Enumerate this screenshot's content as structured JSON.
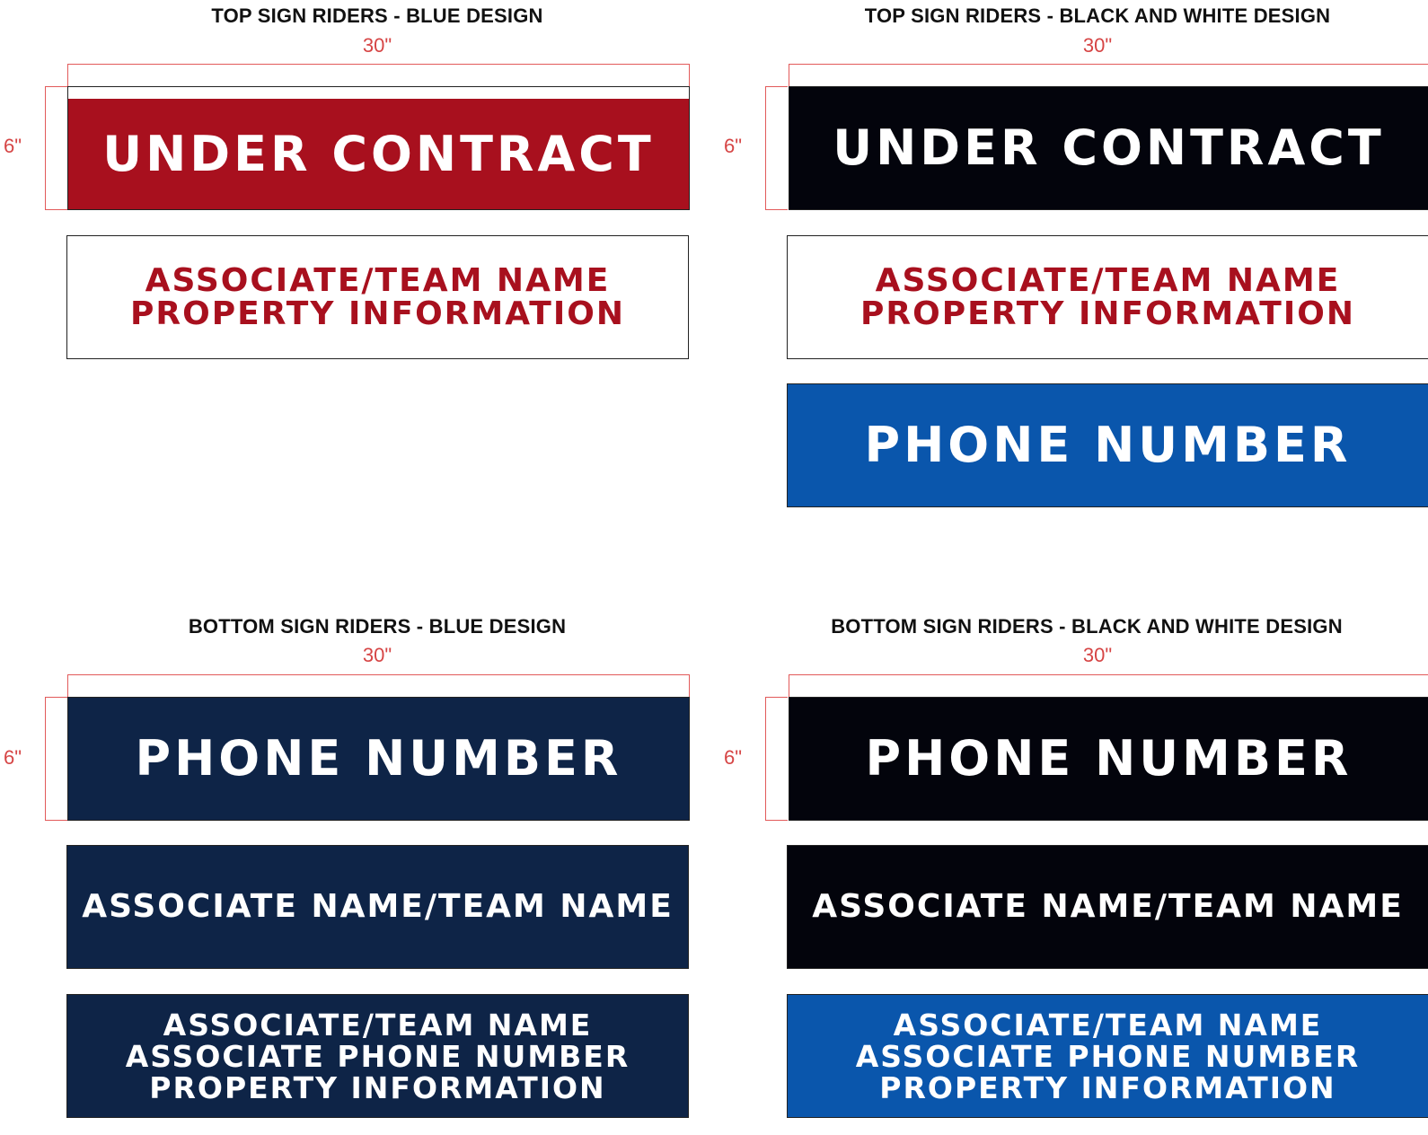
{
  "colors": {
    "red": "#a8101e",
    "black": "#03040c",
    "white": "#ffffff",
    "blue": "#0a56ac",
    "navy": "#0e2447",
    "guide": "#d64545"
  },
  "sections": {
    "top_blue": {
      "title": "TOP SIGN RIDERS - BLUE DESIGN",
      "width_label": "30\"",
      "height_label": "6\"",
      "riders": [
        {
          "lines": [
            "UNDER CONTRACT"
          ]
        },
        {
          "lines": [
            "ASSOCIATE/TEAM NAME",
            "PROPERTY INFORMATION"
          ]
        }
      ]
    },
    "top_bw": {
      "title": "TOP SIGN RIDERS - BLACK AND WHITE DESIGN",
      "width_label": "30\"",
      "height_label": "6\"",
      "riders": [
        {
          "lines": [
            "UNDER CONTRACT"
          ]
        },
        {
          "lines": [
            "ASSOCIATE/TEAM NAME",
            "PROPERTY INFORMATION"
          ]
        },
        {
          "lines": [
            "PHONE NUMBER"
          ]
        }
      ]
    },
    "bottom_blue": {
      "title": "BOTTOM SIGN RIDERS - BLUE DESIGN",
      "width_label": "30\"",
      "height_label": "6\"",
      "riders": [
        {
          "lines": [
            "PHONE NUMBER"
          ]
        },
        {
          "lines": [
            "ASSOCIATE NAME/TEAM NAME"
          ]
        },
        {
          "lines": [
            "ASSOCIATE/TEAM NAME",
            "ASSOCIATE PHONE NUMBER",
            "PROPERTY INFORMATION"
          ]
        }
      ]
    },
    "bottom_bw": {
      "title": "BOTTOM SIGN RIDERS - BLACK AND WHITE DESIGN",
      "width_label": "30\"",
      "height_label": "6\"",
      "riders": [
        {
          "lines": [
            "PHONE NUMBER"
          ]
        },
        {
          "lines": [
            "ASSOCIATE NAME/TEAM NAME"
          ]
        },
        {
          "lines": [
            "ASSOCIATE/TEAM NAME",
            "ASSOCIATE PHONE NUMBER",
            "PROPERTY INFORMATION"
          ]
        }
      ]
    }
  }
}
